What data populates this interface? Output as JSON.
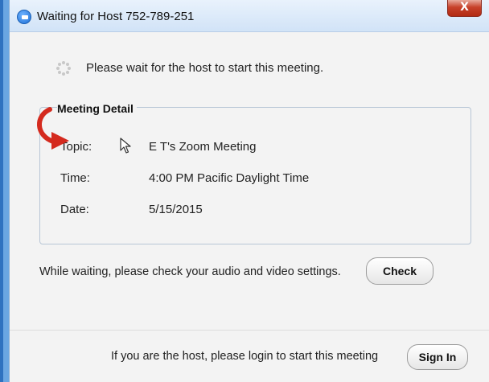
{
  "window": {
    "title": "Waiting for Host 752-789-251",
    "close_label": "X"
  },
  "status": {
    "message": "Please wait for the host to start this meeting."
  },
  "meeting_detail": {
    "heading": "Meeting Detail",
    "topic_label": "Topic:",
    "topic_value": "E T's Zoom Meeting",
    "time_label": "Time:",
    "time_value": "4:00 PM Pacific Daylight Time",
    "date_label": "Date:",
    "date_value": "5/15/2015"
  },
  "settings_hint": {
    "text": "While waiting, please check your audio and video settings.",
    "check_label": "Check"
  },
  "footer": {
    "text": "If you are the host, please login to start this meeting",
    "signin_label": "Sign In"
  },
  "colors": {
    "annotation_arrow": "#d42a1e",
    "close_button": "#c7412a"
  },
  "icons": {
    "spinner": "loading-spinner-icon",
    "arrow": "curved-arrow-icon",
    "cursor": "mouse-pointer-icon",
    "app": "zoom-logo-icon"
  }
}
